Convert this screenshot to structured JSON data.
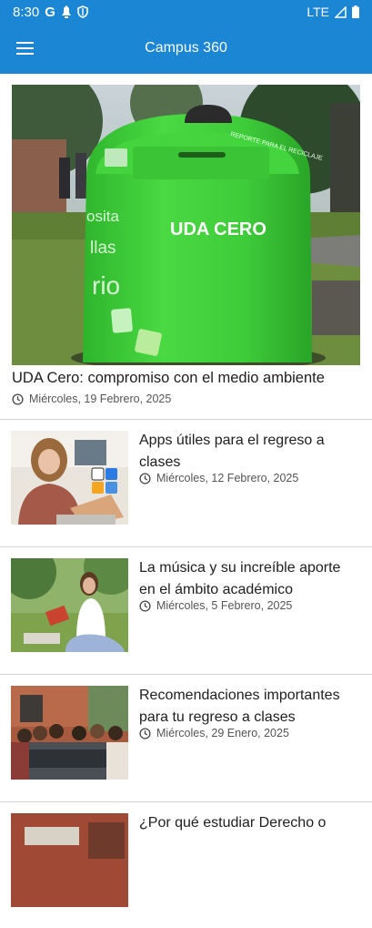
{
  "status_bar": {
    "time": "8:30",
    "g_glyph": "G",
    "network": "LTE"
  },
  "app_bar": {
    "title": "Campus 360",
    "menu_icon": "hamburger-menu-icon"
  },
  "featured": {
    "title": "UDA Cero: compromiso con el medio ambiente",
    "date": "Miércoles, 19 Febrero, 2025",
    "image_text": "UDA CERO",
    "image_side_text": [
      "osita",
      "llas",
      "rio"
    ],
    "image_lid_text": "REPORTE PARA EL RECICLAJE"
  },
  "articles": [
    {
      "title": "Apps útiles para el regreso a clases",
      "date": "Miércoles, 12 Febrero, 2025"
    },
    {
      "title": "La música y su increíble aporte en el ámbito académico",
      "date": "Miércoles, 5 Febrero, 2025"
    },
    {
      "title": "Recomendaciones importantes para tu regreso a clases",
      "date": "Miércoles, 29 Enero, 2025"
    },
    {
      "title": "¿Por qué estudiar Derecho o",
      "date": ""
    }
  ],
  "colors": {
    "primary": "#1a86d4",
    "bin_green": "#44d63f",
    "text": "#202020",
    "muted": "#555555"
  }
}
